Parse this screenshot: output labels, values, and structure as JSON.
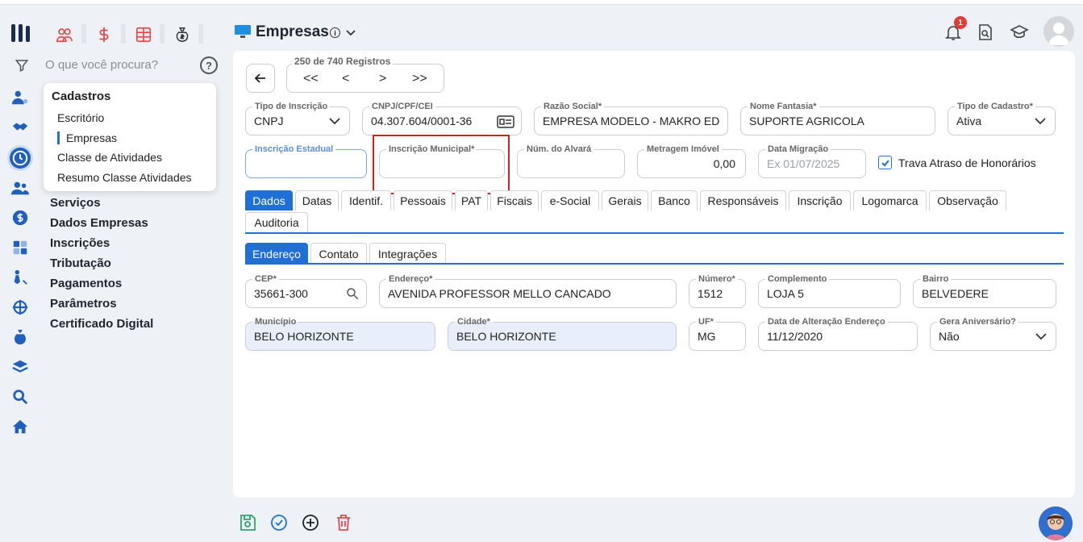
{
  "search": {
    "placeholder": "O que você procura?"
  },
  "submenu": {
    "title": "Cadastros",
    "items": [
      "Escritório",
      "Empresas",
      "Classe de Atividades",
      "Resumo Classe Atividades"
    ]
  },
  "nav": [
    "Serviços",
    "Dados Empresas",
    "Inscrições",
    "Tributação",
    "Pagamentos",
    "Parâmetros",
    "Certificado Digital"
  ],
  "header": {
    "title": "Empresas",
    "notif_count": "1"
  },
  "pager": {
    "label": "250 de 740 Registros",
    "first": "<<",
    "prev": "<",
    "next": ">",
    "last": ">>"
  },
  "form": {
    "tipo_inscricao": {
      "label": "Tipo de Inscrição",
      "value": "CNPJ"
    },
    "cnpj": {
      "label": "CNPJ/CPF/CEI",
      "value": "04.307.604/0001-36"
    },
    "razao_social": {
      "label": "Razão Social*",
      "value": "EMPRESA MODELO - MAKRO EDU..."
    },
    "nome_fantasia": {
      "label": "Nome Fantasia*",
      "value": "SUPORTE AGRICOLA"
    },
    "tipo_cadastro": {
      "label": "Tipo de Cadastro*",
      "value": "Ativa"
    },
    "inscricao_estadual": {
      "label": "Inscrição Estadual",
      "value": ""
    },
    "inscricao_municipal": {
      "label": "Inscrição Municipal*",
      "value": ""
    },
    "num_alvara": {
      "label": "Núm. do Alvará",
      "value": ""
    },
    "metragem": {
      "label": "Metragem Imóvel",
      "value": "0,00"
    },
    "data_migracao": {
      "label": "Data Migração",
      "placeholder": "Ex 01/07/2025"
    },
    "trava": {
      "label": "Trava Atraso de Honorários",
      "checked": true
    }
  },
  "tabs": [
    "Dados",
    "Datas",
    "Identif.",
    "Pessoais",
    "PAT",
    "Fiscais",
    "e-Social",
    "Gerais",
    "Banco",
    "Responsáveis",
    "Inscrição",
    "Logomarca",
    "Observação",
    "Auditoria"
  ],
  "subtabs": [
    "Endereço",
    "Contato",
    "Integrações"
  ],
  "address": {
    "cep": {
      "label": "CEP*",
      "value": "35661-300"
    },
    "endereco": {
      "label": "Endereço*",
      "value": "AVENIDA PROFESSOR MELLO CANCADO"
    },
    "numero": {
      "label": "Número*",
      "value": "1512"
    },
    "complemento": {
      "label": "Complemento",
      "value": "LOJA 5"
    },
    "bairro": {
      "label": "Bairro",
      "value": "BELVEDERE"
    },
    "municipio": {
      "label": "Município",
      "value": "BELO HORIZONTE"
    },
    "cidade": {
      "label": "Cidade*",
      "value": "BELO HORIZONTE"
    },
    "uf": {
      "label": "UF*",
      "value": "MG"
    },
    "data_alteracao": {
      "label": "Data de Alteração Endereço",
      "value": "11/12/2020"
    },
    "gera_aniversario": {
      "label": "Gera Aniversário?",
      "value": "Não"
    }
  },
  "colors": {
    "accent": "#1f6fd6",
    "highlight": "#d61f1f"
  }
}
